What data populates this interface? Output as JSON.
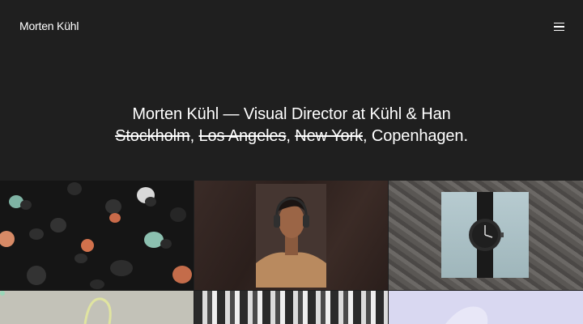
{
  "header": {
    "logo": "Morten Kühl",
    "menu_icon": "hamburger-menu-icon"
  },
  "hero": {
    "line1": "Morten Kühl — Visual Director at Kühl & Han",
    "cities_struck": [
      "Stockholm",
      "Los Angeles",
      "New York"
    ],
    "sep1": ", ",
    "sep2": ", ",
    "sep3": ", ",
    "current_city": "Copenhagen."
  },
  "gallery": {
    "tiles": [
      {
        "subject": "earbuds"
      },
      {
        "subject": "portrait-headphones"
      },
      {
        "subject": "watch"
      },
      {
        "subject": "cable"
      },
      {
        "subject": "building"
      },
      {
        "subject": "lavender-object"
      }
    ]
  }
}
